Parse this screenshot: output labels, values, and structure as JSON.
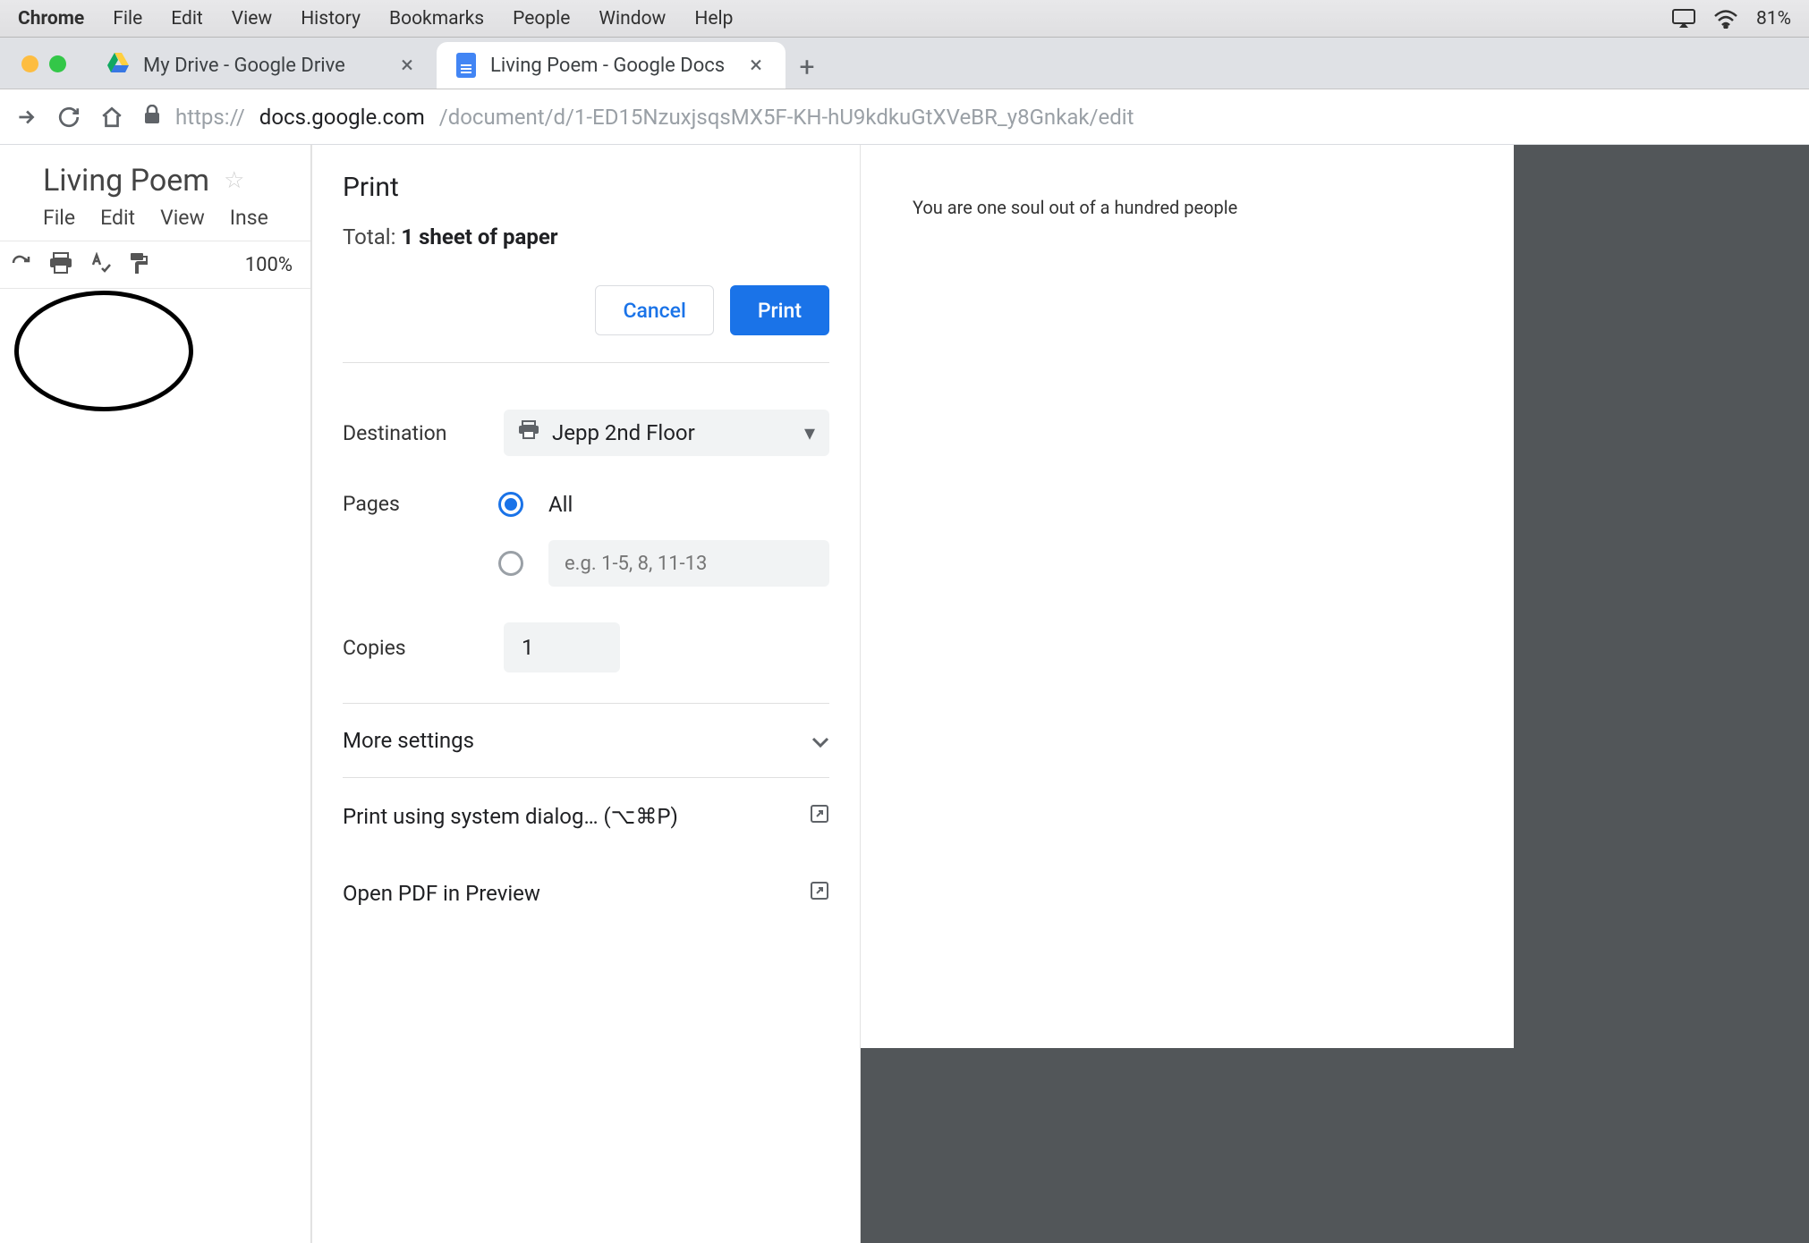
{
  "menubar": {
    "app": "Chrome",
    "items": [
      "File",
      "Edit",
      "View",
      "History",
      "Bookmarks",
      "People",
      "Window",
      "Help"
    ],
    "battery": "81%"
  },
  "tabs": [
    {
      "title": "My Drive - Google Drive",
      "active": false
    },
    {
      "title": "Living Poem - Google Docs",
      "active": true
    }
  ],
  "url": {
    "scheme": "https://",
    "host": "docs.google.com",
    "path": "/document/d/1-ED15NzuxjsqsMX5F-KH-hU9kdkuGtXVeBR_y8Gnkak/edit"
  },
  "doc": {
    "title": "Living Poem",
    "menus": [
      "File",
      "Edit",
      "View",
      "Inse"
    ],
    "zoom": "100%"
  },
  "print": {
    "title": "Print",
    "total_prefix": "Total: ",
    "total_value": "1 sheet of paper",
    "cancel": "Cancel",
    "print_btn": "Print",
    "dest_label": "Destination",
    "dest_value": "Jepp 2nd Floor",
    "pages_label": "Pages",
    "pages_all": "All",
    "pages_range_placeholder": "e.g. 1-5, 8, 11-13",
    "copies_label": "Copies",
    "copies_value": "1",
    "more": "More settings",
    "systemdialog": "Print using system dialog… (⌥⌘P)",
    "openpdf": "Open PDF in Preview"
  },
  "preview_text": "You are one soul out of a hundred people"
}
